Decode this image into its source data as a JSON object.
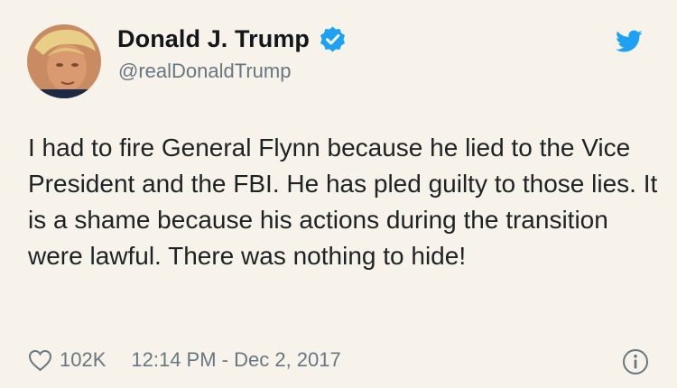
{
  "user": {
    "display_name": "Donald J. Trump",
    "handle": "@realDonaldTrump",
    "verified": true
  },
  "tweet": {
    "text": "I had to fire General Flynn because he lied to the Vice President and the FBI. He has pled guilty to those lies. It is a shame because his actions during the transition were lawful. There was nothing to hide!",
    "likes": "102K",
    "timestamp": "12:14 PM - Dec 2, 2017"
  },
  "icons": {
    "brand": "twitter-bird-icon",
    "verified": "verified-badge-icon",
    "like": "heart-icon",
    "info": "info-icon"
  },
  "colors": {
    "background": "#f8f3ea",
    "brand_blue": "#1da1f2",
    "muted": "#687682"
  }
}
